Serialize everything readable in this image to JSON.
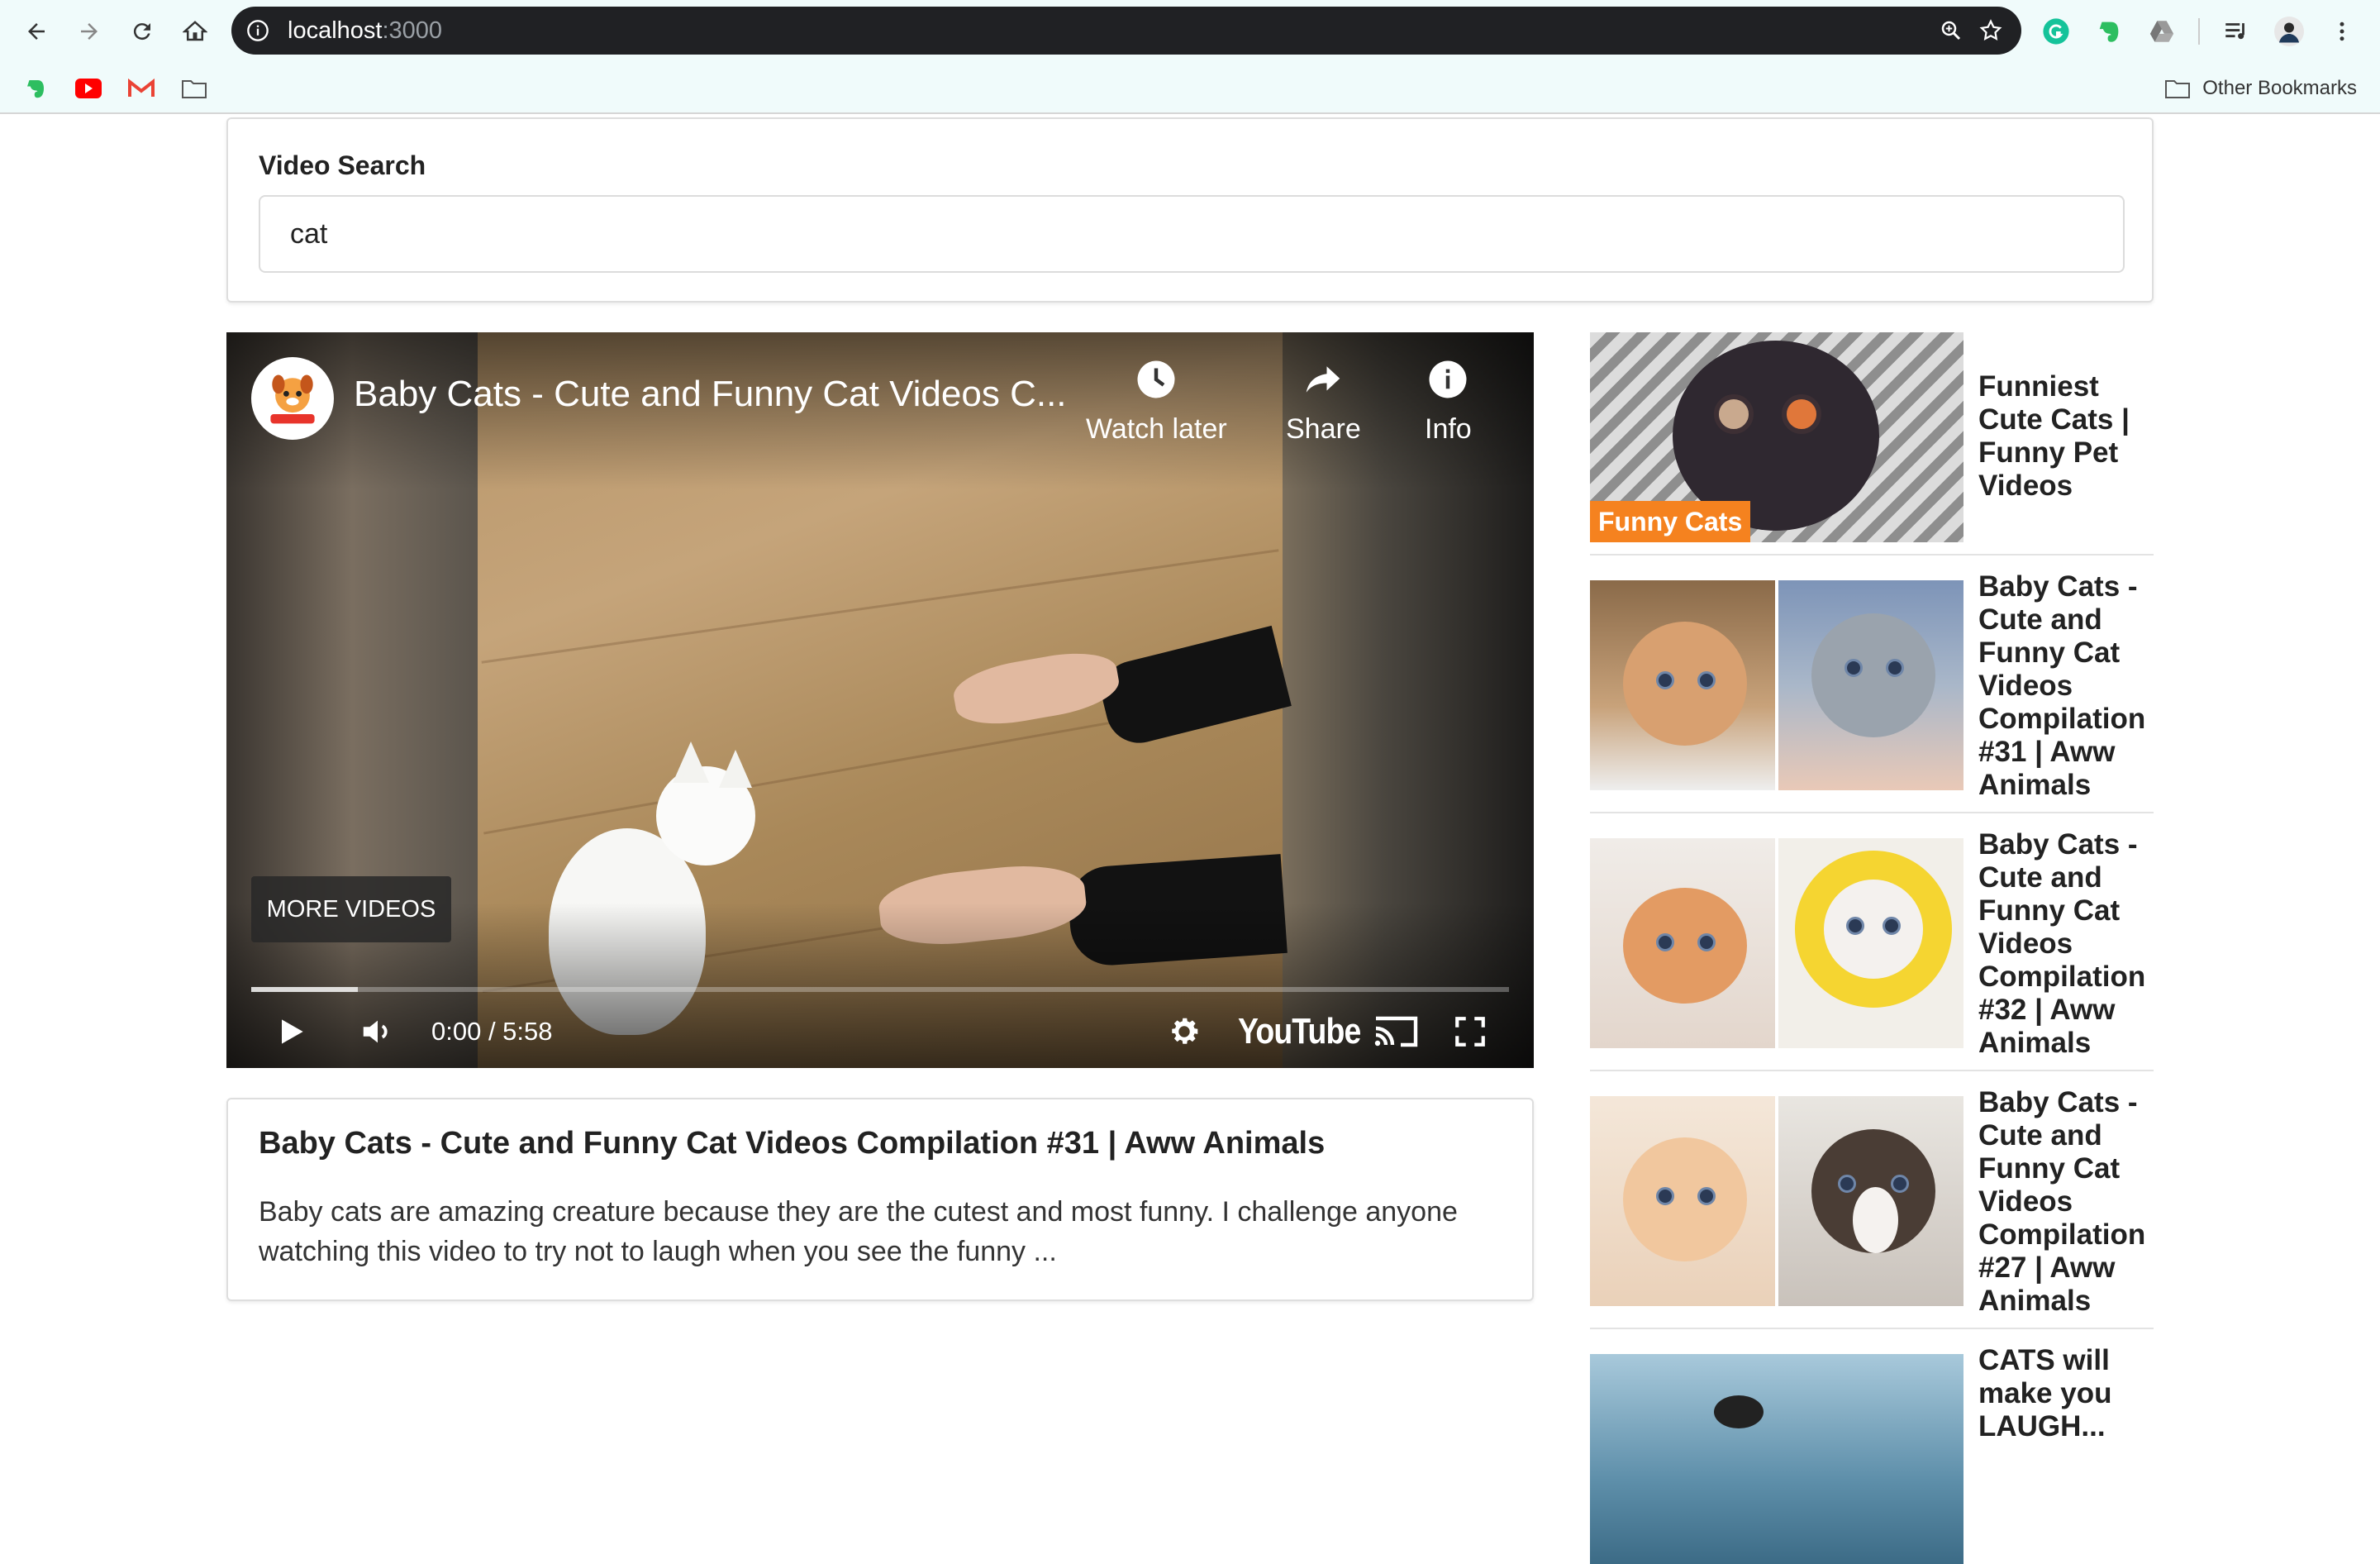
{
  "browser": {
    "url_host": "localhost",
    "url_port": ":3000",
    "other_bookmarks": "Other Bookmarks"
  },
  "search": {
    "label": "Video Search",
    "value": "cat"
  },
  "player": {
    "title": "Baby Cats - Cute and Funny Cat Videos C...",
    "watch_later": "Watch later",
    "share": "Share",
    "info": "Info",
    "more_videos": "MORE VIDEOS",
    "time": "0:00 / 5:58",
    "brand": "YouTube",
    "progress": 0.085
  },
  "detail": {
    "title": "Baby Cats - Cute and Funny Cat Videos Compilation #31 | Aww Animals",
    "description": "Baby cats are amazing creature because they are the cutest and most funny. I challenge anyone watching this video to try not to laugh when you see the funny ..."
  },
  "videos": [
    {
      "title": "Funniest Cute Cats | Funny Pet Videos",
      "thumb_badge": "Funny Cats"
    },
    {
      "title": "Baby Cats - Cute and Funny Cat Videos Compilation #31 | Aww Animals"
    },
    {
      "title": "Baby Cats - Cute and Funny Cat Videos Compilation #32 | Aww Animals"
    },
    {
      "title": "Baby Cats - Cute and Funny Cat Videos Compilation #27 | Aww Animals"
    },
    {
      "title": "CATS will make you LAUGH..."
    }
  ],
  "colors": {
    "chrome_bg": "#f0fbfb",
    "omnibox_bg": "#202124",
    "badge_orange": "#f5821f"
  }
}
